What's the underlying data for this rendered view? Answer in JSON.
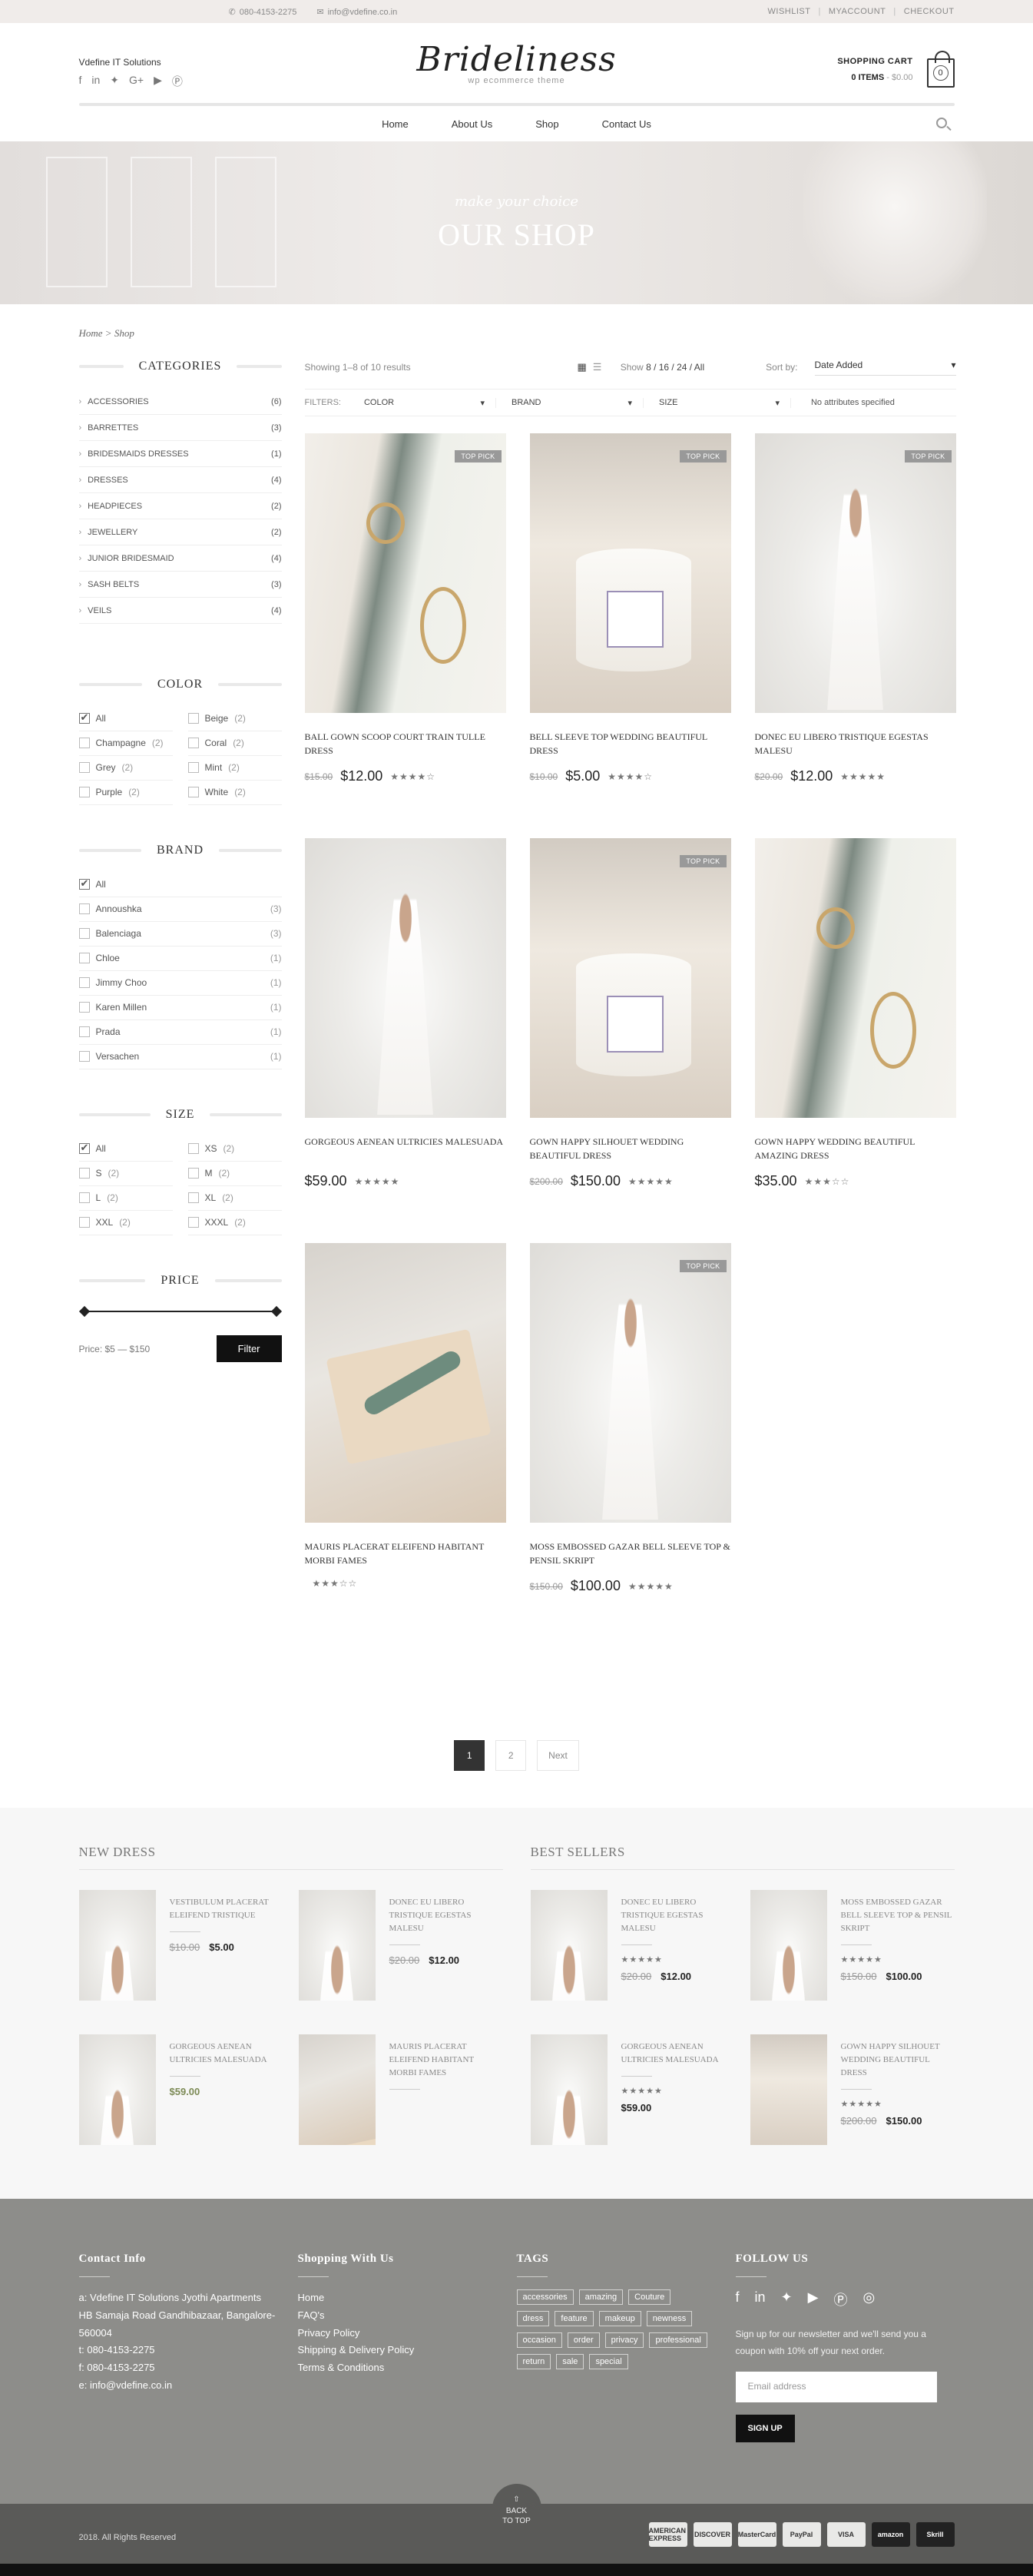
{
  "topbar": {
    "phone": "080-4153-2275",
    "email": "info@vdefine.co.in",
    "links": [
      "WISHLIST",
      "MYACCOUNT",
      "CHECKOUT"
    ]
  },
  "header": {
    "company": "Vdefine IT Solutions",
    "social_icons": [
      "facebook-icon",
      "linkedin-icon",
      "twitter-icon",
      "google-plus-icon",
      "youtube-icon",
      "pinterest-icon"
    ],
    "logo": "Brideliness",
    "tagline": "wp ecommerce theme",
    "cart_title": "SHOPPING CART",
    "cart_items": "0 ITEMS",
    "cart_total": "- $0.00",
    "cart_count": "0"
  },
  "nav": [
    "Home",
    "About Us",
    "Shop",
    "Contact Us"
  ],
  "banner": {
    "script": "make your choice",
    "title": "OUR SHOP"
  },
  "breadcrumb": {
    "home": "Home",
    "sep": " > ",
    "current": "Shop"
  },
  "sidebar": {
    "categories_title": "CATEGORIES",
    "categories": [
      {
        "label": "ACCESSORIES",
        "count": "(6)"
      },
      {
        "label": "BARRETTES",
        "count": "(3)"
      },
      {
        "label": "BRIDESMAIDS DRESSES",
        "count": "(1)"
      },
      {
        "label": "DRESSES",
        "count": "(4)"
      },
      {
        "label": "HEADPIECES",
        "count": "(2)"
      },
      {
        "label": "JEWELLERY",
        "count": "(2)"
      },
      {
        "label": "JUNIOR BRIDESMAID",
        "count": "(4)"
      },
      {
        "label": "SASH BELTS",
        "count": "(3)"
      },
      {
        "label": "VEILS",
        "count": "(4)"
      }
    ],
    "color_title": "COLOR",
    "colors": [
      {
        "label": "All",
        "count": "",
        "checked": true
      },
      {
        "label": "Beige",
        "count": "(2)"
      },
      {
        "label": "Champagne",
        "count": "(2)"
      },
      {
        "label": "Coral",
        "count": "(2)"
      },
      {
        "label": "Grey",
        "count": "(2)"
      },
      {
        "label": "Mint",
        "count": "(2)"
      },
      {
        "label": "Purple",
        "count": "(2)"
      },
      {
        "label": "White",
        "count": "(2)"
      }
    ],
    "brand_title": "BRAND",
    "brands": [
      {
        "label": "All",
        "count": "",
        "checked": true
      },
      {
        "label": "Annoushka",
        "count": "(3)"
      },
      {
        "label": "Balenciaga",
        "count": "(3)"
      },
      {
        "label": "Chloe",
        "count": "(1)"
      },
      {
        "label": "Jimmy Choo",
        "count": "(1)"
      },
      {
        "label": "Karen Millen",
        "count": "(1)"
      },
      {
        "label": "Prada",
        "count": "(1)"
      },
      {
        "label": "Versachen",
        "count": "(1)"
      }
    ],
    "size_title": "SIZE",
    "sizes": [
      {
        "label": "All",
        "count": "",
        "checked": true
      },
      {
        "label": "XS",
        "count": "(2)"
      },
      {
        "label": "S",
        "count": "(2)"
      },
      {
        "label": "M",
        "count": "(2)"
      },
      {
        "label": "L",
        "count": "(2)"
      },
      {
        "label": "XL",
        "count": "(2)"
      },
      {
        "label": "XXL",
        "count": "(2)"
      },
      {
        "label": "XXXL",
        "count": "(2)"
      }
    ],
    "price_title": "PRICE",
    "price_label": "Price: $5 — $150",
    "filter_button": "Filter"
  },
  "toolbar": {
    "results": "Showing 1–8 of 10 results",
    "show_label": "Show",
    "show_options": "8 / 16 / 24 / All",
    "sort_label": "Sort by:",
    "sort_value": "Date Added",
    "filters_label": "FILTERS:",
    "filter_color": "COLOR",
    "filter_brand": "BRAND",
    "filter_size": "SIZE",
    "no_attributes": "No attributes specified"
  },
  "products": [
    {
      "name": "BALL GOWN SCOOP COURT TRAIN TULLE DRESS",
      "old": "$15.00",
      "price": "$12.00",
      "stars": "★★★★☆",
      "badge": "TOP PICK",
      "img": "jewel"
    },
    {
      "name": "BELL SLEEVE TOP WEDDING BEAUTIFUL DRESS",
      "old": "$10.00",
      "price": "$5.00",
      "stars": "★★★★☆",
      "badge": "TOP PICK",
      "img": "candle"
    },
    {
      "name": "DONEC EU LIBERO TRISTIQUE EGESTAS MALESU",
      "old": "$20.00",
      "price": "$12.00",
      "stars": "★★★★★",
      "badge": "TOP PICK",
      "img": "dress"
    },
    {
      "name": "GORGEOUS AENEAN ULTRICIES MALESUADA",
      "old": "",
      "price": "$59.00",
      "stars": "★★★★★",
      "badge": "",
      "img": "dress"
    },
    {
      "name": "GOWN HAPPY SILHOUET WEDDING BEAUTIFUL DRESS",
      "old": "$200.00",
      "price": "$150.00",
      "stars": "★★★★★",
      "badge": "TOP PICK",
      "img": "candle"
    },
    {
      "name": "GOWN HAPPY WEDDING BEAUTIFUL AMAZING DRESS",
      "old": "",
      "price": "$35.00",
      "stars": "★★★☆☆",
      "badge": "",
      "img": "jewel"
    },
    {
      "name": "MAURIS PLACERAT ELEIFEND HABITANT MORBI FAMES",
      "old": "",
      "price": "",
      "stars": "★★★☆☆",
      "badge": "",
      "img": "box"
    },
    {
      "name": "MOSS EMBOSSED GAZAR BELL SLEEVE TOP & PENSIL SKRIPT",
      "old": "$150.00",
      "price": "$100.00",
      "stars": "★★★★★",
      "badge": "TOP PICK",
      "img": "dress"
    }
  ],
  "pagination": [
    "1",
    "2",
    "Next"
  ],
  "new_dress": {
    "title": "NEW DRESS",
    "items": [
      {
        "name": "VESTIBULUM PLACERAT ELEIFEND TRISTIQUE",
        "old": "$10.00",
        "price": "$5.00",
        "stars": "",
        "img": "dress"
      },
      {
        "name": "DONEC EU LIBERO TRISTIQUE EGESTAS MALESU",
        "old": "$20.00",
        "price": "$12.00",
        "stars": "",
        "img": "dress"
      },
      {
        "name": "GORGEOUS AENEAN ULTRICIES MALESUADA",
        "old": "",
        "price": "$59.00",
        "stars": "",
        "img": "dress",
        "sale": true
      },
      {
        "name": "MAURIS PLACERAT ELEIFEND HABITANT MORBI FAMES",
        "old": "",
        "price": "",
        "stars": "",
        "img": "box"
      }
    ]
  },
  "best_sellers": {
    "title": "BEST SELLERS",
    "items": [
      {
        "name": "DONEC EU LIBERO TRISTIQUE EGESTAS MALESU",
        "old": "$20.00",
        "price": "$12.00",
        "stars": "★★★★★",
        "img": "dress"
      },
      {
        "name": "MOSS EMBOSSED GAZAR BELL SLEEVE TOP & PENSIL SKRIPT",
        "old": "$150.00",
        "price": "$100.00",
        "stars": "★★★★★",
        "img": "dress"
      },
      {
        "name": "GORGEOUS AENEAN ULTRICIES MALESUADA",
        "old": "",
        "price": "$59.00",
        "stars": "★★★★★",
        "img": "dress"
      },
      {
        "name": "GOWN HAPPY SILHOUET WEDDING BEAUTIFUL DRESS",
        "old": "$200.00",
        "price": "$150.00",
        "stars": "★★★★★",
        "img": "candle"
      }
    ]
  },
  "footer": {
    "contact_title": "Contact Info",
    "contact_lines": [
      "a: Vdefine IT Solutions Jyothi Apartments",
      "HB Samaja Road Gandhibazaar, Bangalore-",
      "560004",
      "t: 080-4153-2275",
      "f: 080-4153-2275",
      "e: info@vdefine.co.in"
    ],
    "shopping_title": "Shopping With Us",
    "shopping_links": [
      "Home",
      "FAQ's",
      "Privacy Policy",
      "Shipping & Delivery Policy",
      "Terms & Conditions"
    ],
    "tags_title": "TAGS",
    "tags": [
      "accessories",
      "amazing",
      "Couture",
      "dress",
      "feature",
      "makeup",
      "newness",
      "occasion",
      "order",
      "privacy",
      "professional",
      "return",
      "sale",
      "special"
    ],
    "follow_title": "FOLLOW US",
    "follow_icons": [
      "facebook-icon",
      "linkedin-icon",
      "twitter-icon",
      "youtube-icon",
      "pinterest-icon",
      "dribbble-icon"
    ],
    "newsletter": "Sign up for our newsletter and we'll send you a coupon with 10% off your next order.",
    "email_placeholder": "Email address",
    "signup": "SIGN UP"
  },
  "bottom": {
    "copyright": "2018. All Rights Reserved",
    "back_to_top": "BACK TO TOP",
    "payments": [
      "AMERICAN EXPRESS",
      "DISCOVER",
      "MasterCard",
      "PayPal",
      "VISA",
      "amazon",
      "Skrill"
    ]
  }
}
